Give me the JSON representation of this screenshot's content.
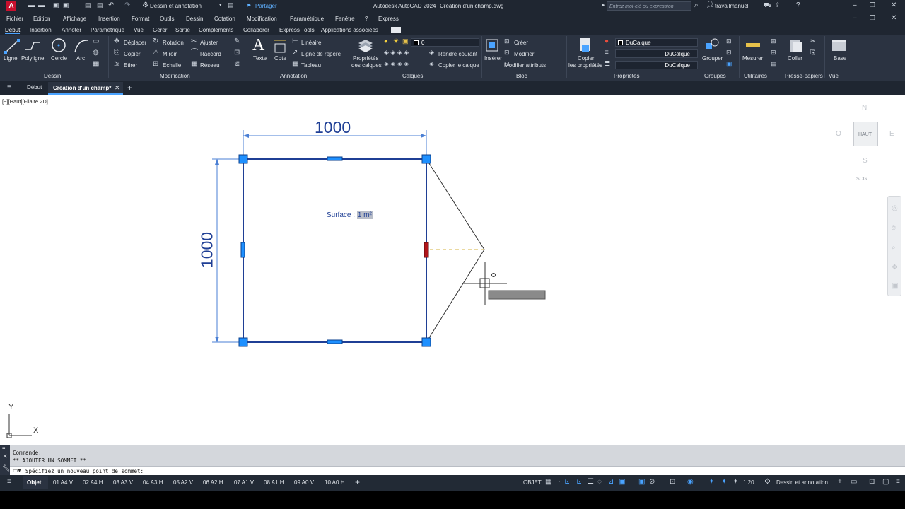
{
  "titlebar": {
    "workspace": "Dessin et annotation",
    "share": "Partager",
    "app_title": "Autodesk AutoCAD 2024",
    "doc_title": "Création d'un champ.dwg",
    "search_placeholder": "Entrez mot-clé ou expression",
    "user": "travailmanuel"
  },
  "menu": [
    "Fichier",
    "Edition",
    "Affichage",
    "Insertion",
    "Format",
    "Outils",
    "Dessin",
    "Cotation",
    "Modification",
    "Paramétrique",
    "Fenêtre",
    "?",
    "Express"
  ],
  "ribbon_tabs": [
    "Début",
    "Insertion",
    "Annoter",
    "Paramétrique",
    "Vue",
    "Gérer",
    "Sortie",
    "Compléments",
    "Collaborer",
    "Express Tools",
    "Applications associées"
  ],
  "ribbon": {
    "dessin": {
      "title": "Dessin",
      "ligne": "Ligne",
      "polyligne": "Polyligne",
      "cercle": "Cercle",
      "arc": "Arc"
    },
    "modification": {
      "title": "Modification",
      "deplacer": "Déplacer",
      "rotation": "Rotation",
      "ajuster": "Ajuster",
      "copier": "Copier",
      "miroir": "Miroir",
      "raccord": "Raccord",
      "etirer": "Etirer",
      "echelle": "Echelle",
      "reseau": "Réseau"
    },
    "annotation": {
      "title": "Annotation",
      "texte": "Texte",
      "cote": "Cote",
      "lineaire": "Linéaire",
      "ligne_repere": "Ligne de repère",
      "tableau": "Tableau"
    },
    "calques": {
      "title": "Calques",
      "proprietes_1": "Propriétés",
      "proprietes_2": "des calques",
      "layer_value": "0",
      "rendre_courant": "Rendre courant",
      "copier_calque": "Copier le calque"
    },
    "bloc": {
      "title": "Bloc",
      "inserer": "Insérer",
      "creer": "Créer",
      "modifier": "Modifier",
      "modifier_attributs": "Modifier attributs"
    },
    "proprietes": {
      "title": "Propriétés",
      "copier_1": "Copier",
      "copier_2": "les propriétés",
      "color": "DuCalque",
      "linetype": "DuCalque",
      "lineweight": "DuCalque"
    },
    "groupes": {
      "title": "Groupes",
      "grouper": "Grouper"
    },
    "utilitaires": {
      "title": "Utilitaires",
      "mesurer": "Mesurer"
    },
    "presse_papiers": {
      "title": "Presse-papiers",
      "coller": "Coller"
    },
    "vue": {
      "title": "Vue",
      "base": "Base"
    }
  },
  "doc_tabs": {
    "debut": "Début",
    "active": "Création d'un champ*"
  },
  "viewport": {
    "label": "[−][Haut][Filaire 2D]",
    "dim_horizontal": "1000",
    "dim_vertical": "1000",
    "field_label": "Surface : ",
    "field_value": "1 m²",
    "viewcube": {
      "n": "N",
      "s": "S",
      "e": "E",
      "o": "O",
      "face": "HAUT",
      "ucs": "SCG"
    },
    "ucs_x": "X",
    "ucs_y": "Y"
  },
  "command": {
    "line1": "Commande:",
    "line2": "** AJOUTER UN SOMMET **",
    "prompt": "Spécifiez un nouveau point de sommet:"
  },
  "layout_tabs": [
    "Objet",
    "01 A4 V",
    "02 A4 H",
    "03 A3 V",
    "04 A3 H",
    "05 A2 V",
    "06 A2 H",
    "07 A1 V",
    "08 A1 H",
    "09 A0 V",
    "10 A0 H"
  ],
  "status": {
    "mode": "OBJET",
    "scale": "1:20",
    "workspace": "Dessin et annotation"
  },
  "colors": {
    "accent": "#4aa3ff",
    "grip": "#1e90ff",
    "grip_hot": "#b0141a",
    "drawing_blue": "#1f3f95"
  }
}
